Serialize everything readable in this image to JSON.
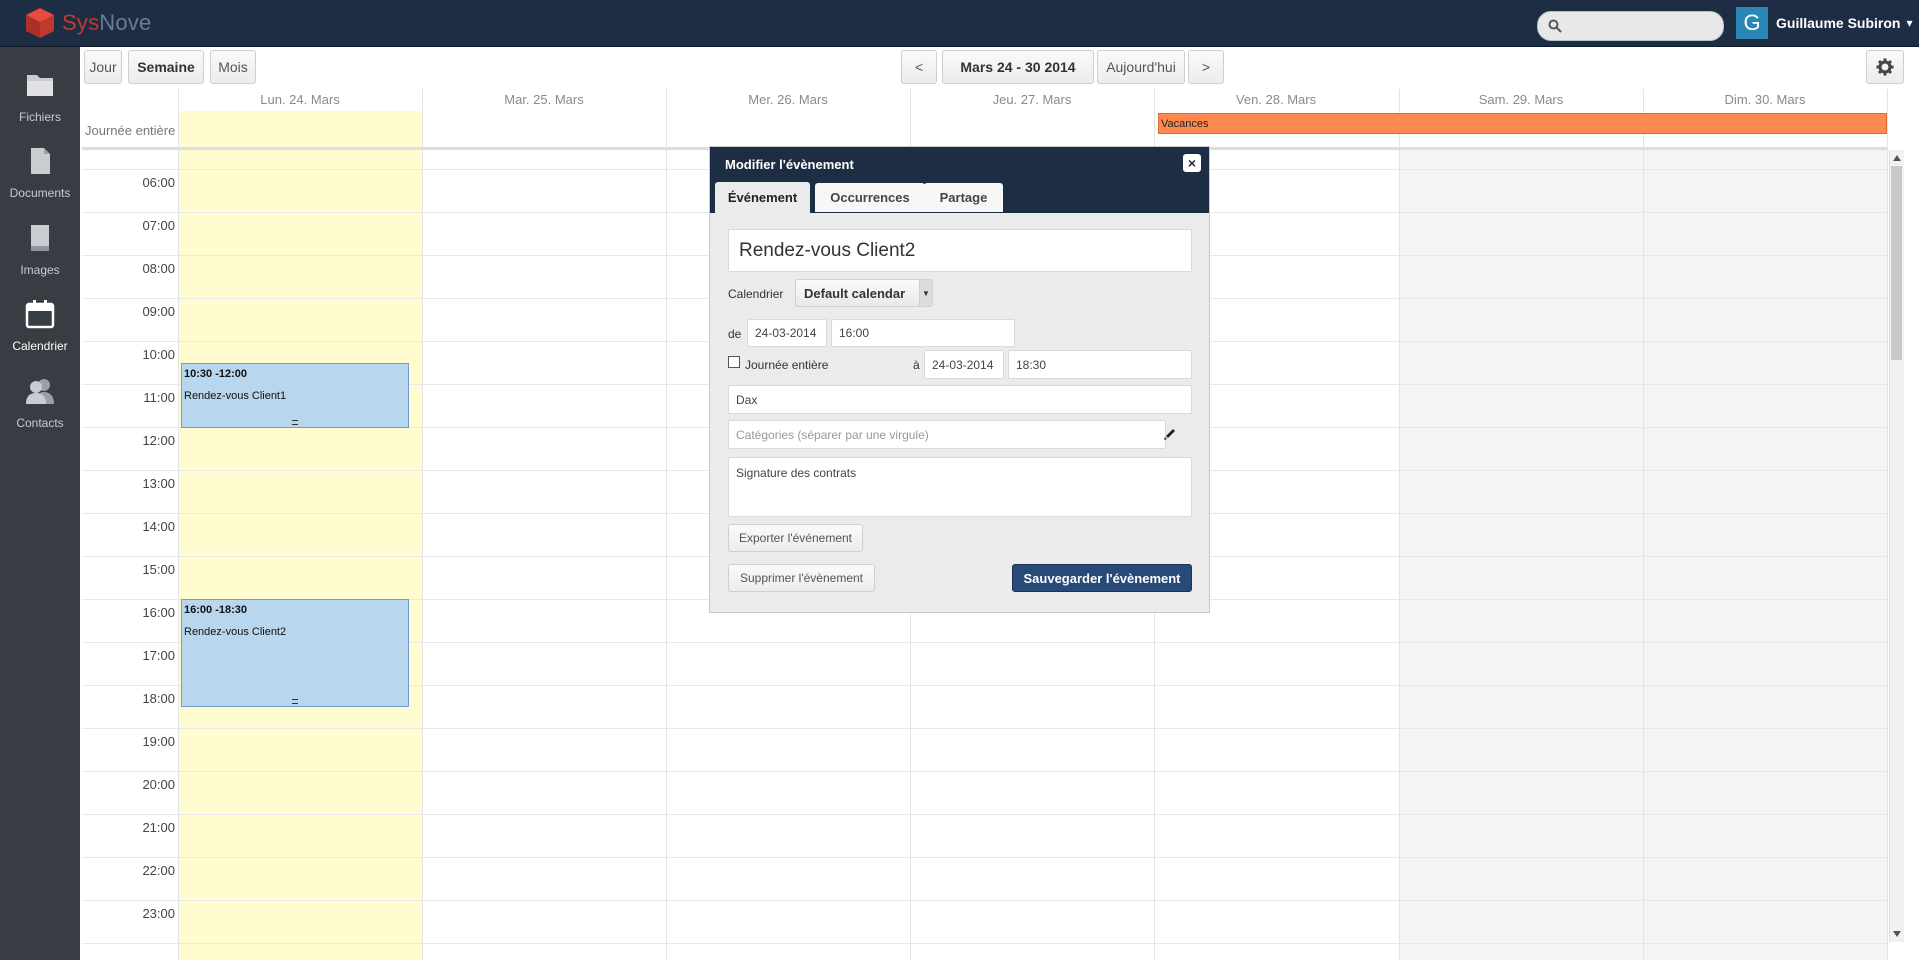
{
  "app": {
    "logo_text_prefix": "Sys",
    "logo_text_suffix": "Nove"
  },
  "header": {
    "search_placeholder": "",
    "user_initial": "G",
    "user_name": "Guillaume Subiron",
    "user_caret": "▾"
  },
  "sidebar": {
    "items": [
      {
        "label": "Fichiers",
        "icon": "folder-icon"
      },
      {
        "label": "Documents",
        "icon": "document-icon"
      },
      {
        "label": "Images",
        "icon": "image-icon"
      },
      {
        "label": "Calendrier",
        "icon": "calendar-icon",
        "active": true
      },
      {
        "label": "Contacts",
        "icon": "contacts-icon"
      }
    ]
  },
  "toolbar": {
    "view_day": "Jour",
    "view_week": "Semaine",
    "view_month": "Mois",
    "prev": "<",
    "range": "Mars 24 - 30 2014",
    "today": "Aujourd'hui",
    "next": ">",
    "settings_icon": "gear-icon"
  },
  "calendar": {
    "allday_label": "Journée entière",
    "days": [
      "Lun. 24. Mars",
      "Mar. 25. Mars",
      "Mer. 26. Mars",
      "Jeu. 27. Mars",
      "Ven. 28. Mars",
      "Sam. 29. Mars",
      "Dim. 30. Mars"
    ],
    "hours": [
      "06:00",
      "07:00",
      "08:00",
      "09:00",
      "10:00",
      "11:00",
      "12:00",
      "13:00",
      "14:00",
      "15:00",
      "16:00",
      "17:00",
      "18:00",
      "19:00",
      "20:00",
      "21:00",
      "22:00",
      "23:00"
    ],
    "events": [
      {
        "time": "10:30 -12:00",
        "title": "Rendez-vous Client1"
      },
      {
        "time": "16:00 -18:30",
        "title": "Rendez-vous Client2"
      }
    ],
    "allday_event": "Vacances"
  },
  "modal": {
    "title": "Modifier l'évènement",
    "close": "×",
    "tabs": [
      "Événement",
      "Occurrences",
      "Partage"
    ],
    "event_title": "Rendez-vous Client2",
    "calendar_label": "Calendrier",
    "calendar_value": "Default calendar",
    "from_label": "de",
    "from_date": "24-03-2014",
    "from_time": "16:00",
    "allday_label": "Journée entière",
    "to_label": "à",
    "to_date": "24-03-2014",
    "to_time": "18:30",
    "location": "Dax",
    "categories_placeholder": "Catégories (séparer par une virgule)",
    "description": "Signature des contrats",
    "export_button": "Exporter l'événement",
    "delete_button": "Supprimer l'évènement",
    "save_button": "Sauvegarder l'évènement"
  },
  "colors": {
    "topbar": "#1d2d44",
    "sidebar": "#383c43",
    "today_column": "#fffdcf",
    "event": "#b8d6ee",
    "vacances": "#ff8a4f",
    "primary_button": "#274a78"
  }
}
